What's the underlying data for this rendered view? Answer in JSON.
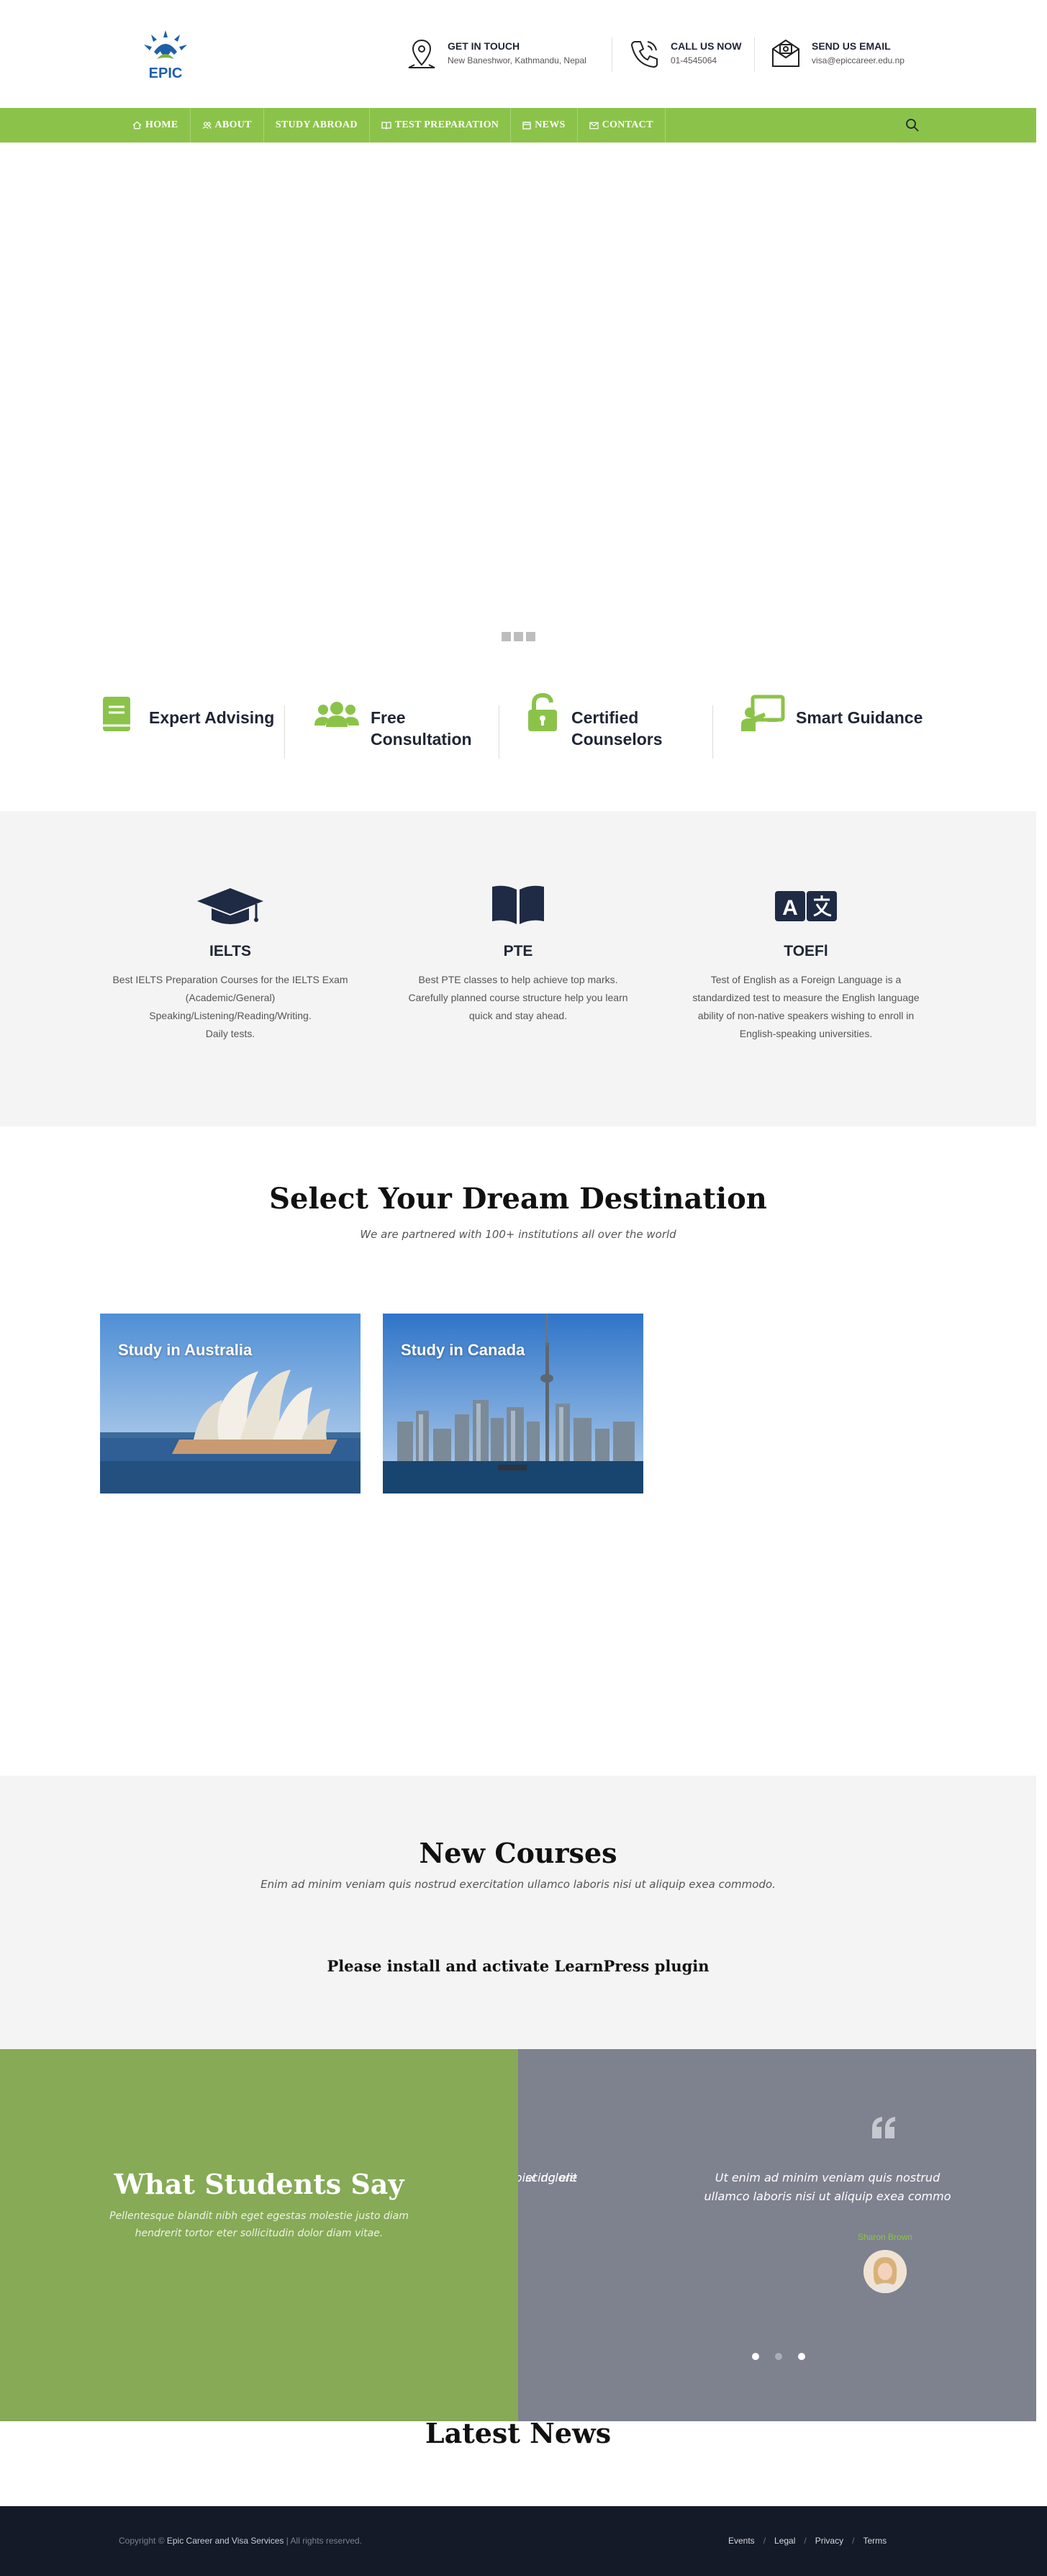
{
  "header": {
    "logo_text": "EPIC",
    "contacts": [
      {
        "title": "GET IN TOUCH",
        "value": "New Baneshwor, Kathmandu, Nepal",
        "icon": "map-pin-icon"
      },
      {
        "title": "CALL US NOW",
        "value": "01-4545064",
        "icon": "phone-icon"
      },
      {
        "title": "SEND US EMAIL",
        "value": "visa@epiccareer.edu.np",
        "icon": "envelope-icon"
      }
    ]
  },
  "nav": {
    "items": [
      {
        "label": "HOME",
        "icon": "home-icon"
      },
      {
        "label": "ABOUT",
        "icon": "users-icon"
      },
      {
        "label": "STUDY ABROAD",
        "icon": ""
      },
      {
        "label": "TEST PREPARATION",
        "icon": "book-open-icon"
      },
      {
        "label": "NEWS",
        "icon": "calendar-icon"
      },
      {
        "label": "CONTACT",
        "icon": "mail-icon"
      }
    ],
    "search_icon": "search-icon"
  },
  "features": [
    {
      "title": "Expert Advising",
      "icon": "book-icon"
    },
    {
      "title": "Free\nConsultation",
      "icon": "users-group-icon"
    },
    {
      "title": "Certified\nCounselors",
      "icon": "unlock-icon"
    },
    {
      "title": "Smart Guidance",
      "icon": "teacher-board-icon"
    }
  ],
  "tests": [
    {
      "name": "IELTS",
      "icon": "graduation-cap-icon",
      "lines": [
        "Best IELTS Preparation Courses for the IELTS Exam",
        "(Academic/General)",
        "Speaking/Listening/Reading/Writing.",
        "Daily tests."
      ]
    },
    {
      "name": "PTE",
      "icon": "open-book-icon",
      "lines": [
        "Best PTE classes to help achieve top marks.",
        "Carefully planned course structure help you learn",
        "quick and stay ahead."
      ]
    },
    {
      "name": "TOEFl",
      "icon": "translate-icon",
      "lines": [
        "Test of English as a Foreign Language is a",
        "standardized test to measure the English language",
        "ability of non-native speakers wishing to enroll in",
        "English-speaking universities."
      ]
    }
  ],
  "destinations": {
    "title": "Select Your Dream Destination",
    "subtitle": "We are partnered with 100+ institutions all over the world",
    "cards": [
      {
        "label": "Study in Australia"
      },
      {
        "label": "Study in Canada"
      }
    ]
  },
  "courses": {
    "title": "New Courses",
    "subtitle": "Enim ad minim veniam quis nostrud exercitation ullamco laboris nisi ut aliquip exea commodo.",
    "message": "Please install and activate LearnPress plugin"
  },
  "testimonials": {
    "title": "What Students Say",
    "subtitle_lines": [
      "Pellentesque blandit nibh eget egestas molestie justo diam",
      "hendrerit tortor eter sollicitudin dolor diam vitae."
    ],
    "prev_lines": [
      "piscing elit",
      "et dolore"
    ],
    "quote_lines": [
      "Ut enim ad minim veniam quis nostrud",
      "ullamco laboris nisi ut aliquip exea commo"
    ],
    "author": "Sharon Brown"
  },
  "news": {
    "title": "Latest News"
  },
  "footer": {
    "copyright_prefix": "Copyright © ",
    "brand": "Epic Career and Visa Services",
    "copyright_suffix": " | All rights reserved.",
    "links": [
      "Events",
      "Legal",
      "Privacy",
      "Terms"
    ]
  },
  "colors": {
    "accent": "#8bc34a",
    "navy": "#1f2a44",
    "footer": "#151a28",
    "testimonial_green": "#86aa56",
    "testimonial_gray": "#7e818e"
  }
}
